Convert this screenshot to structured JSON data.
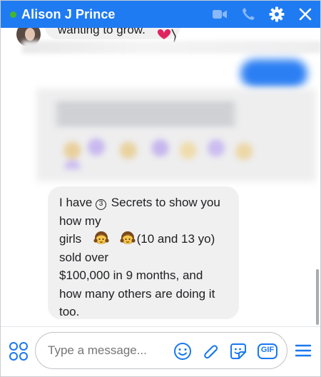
{
  "header": {
    "contact_name": "Alison J Prince",
    "icons": [
      "video-camera-icon",
      "phone-icon",
      "gear-icon",
      "close-icon"
    ]
  },
  "messages": {
    "previous_partial_text": "wanting to grow.",
    "incoming_message": {
      "lines": [
        {
          "before": "I have ",
          "badge": "3",
          "after": " Secrets to show you"
        },
        {
          "text": "how my"
        },
        {
          "before": "girls",
          "emojis": [
            "girl-emoji",
            "girl-emoji"
          ],
          "after": "(10 and 13 yo)"
        },
        {
          "text": "sold over"
        },
        {
          "text": "$100,000 in 9 months, and"
        },
        {
          "text": "how many others are doing it"
        },
        {
          "text": "too."
        }
      ]
    }
  },
  "composer": {
    "placeholder": "Type a message...",
    "icons": [
      "apps-icon",
      "emoji-icon",
      "attachment-icon",
      "sticker-icon",
      "gif-icon",
      "menu-icon"
    ],
    "gif_label": "GIF"
  },
  "colors": {
    "header_bg": "#1f7bf2",
    "online_dot": "#42b72a",
    "bubble_bg": "#f1f0f0",
    "accent": "#1877f2"
  }
}
